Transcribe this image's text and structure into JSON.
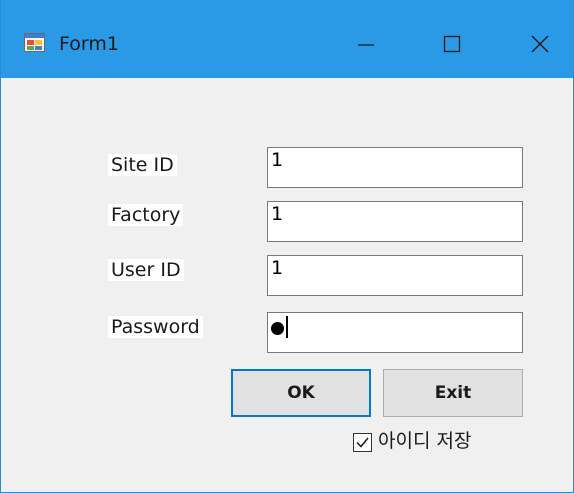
{
  "window": {
    "title": "Form1",
    "icons": {
      "app": "app-form-icon",
      "minimize": "minimize-icon",
      "maximize": "maximize-icon",
      "close": "close-icon"
    },
    "colors": {
      "titlebar": "#2b9ae6",
      "body": "#f0f0f0",
      "accent": "#0078d7"
    }
  },
  "form": {
    "site_id": {
      "label": "Site ID",
      "value": "1"
    },
    "factory": {
      "label": "Factory",
      "value": "1"
    },
    "user_id": {
      "label": "User ID",
      "value": "1"
    },
    "password": {
      "label": "Password",
      "masked_chars": 1
    }
  },
  "buttons": {
    "ok_label": "OK",
    "exit_label": "Exit"
  },
  "save_id": {
    "label": "아이디 저장",
    "checked": true
  }
}
